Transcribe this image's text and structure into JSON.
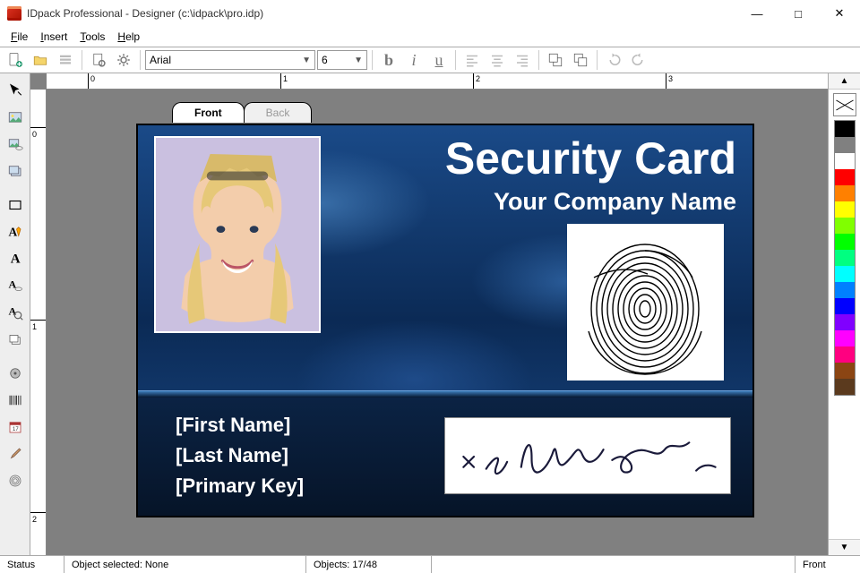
{
  "window": {
    "title": "IDpack Professional - Designer (c:\\idpack\\pro.idp)"
  },
  "menu": {
    "file": "File",
    "insert": "Insert",
    "tools": "Tools",
    "help": "Help"
  },
  "toolbar": {
    "font_name": "Arial",
    "font_size": "6"
  },
  "ruler": {
    "h": [
      "0",
      "1",
      "2",
      "3"
    ],
    "v": [
      "0",
      "1",
      "2"
    ]
  },
  "tabs": {
    "front": "Front",
    "back": "Back"
  },
  "card": {
    "title1": "Security Card",
    "title2": "Your Company Name",
    "field_first": "[First Name]",
    "field_last": "[Last Name]",
    "field_key": "[Primary Key]"
  },
  "palette": [
    "#000000",
    "#808080",
    "#ffffff",
    "#ff0000",
    "#ff8000",
    "#ffff00",
    "#80ff00",
    "#00ff00",
    "#00ff80",
    "#00ffff",
    "#0080ff",
    "#0000ff",
    "#8000ff",
    "#ff00ff",
    "#ff0080",
    "#8b4513",
    "#5b3a1e"
  ],
  "status": {
    "label_status": "Status",
    "object_selected": "Object selected: None",
    "objects": "Objects: 17/48",
    "side": "Front"
  }
}
